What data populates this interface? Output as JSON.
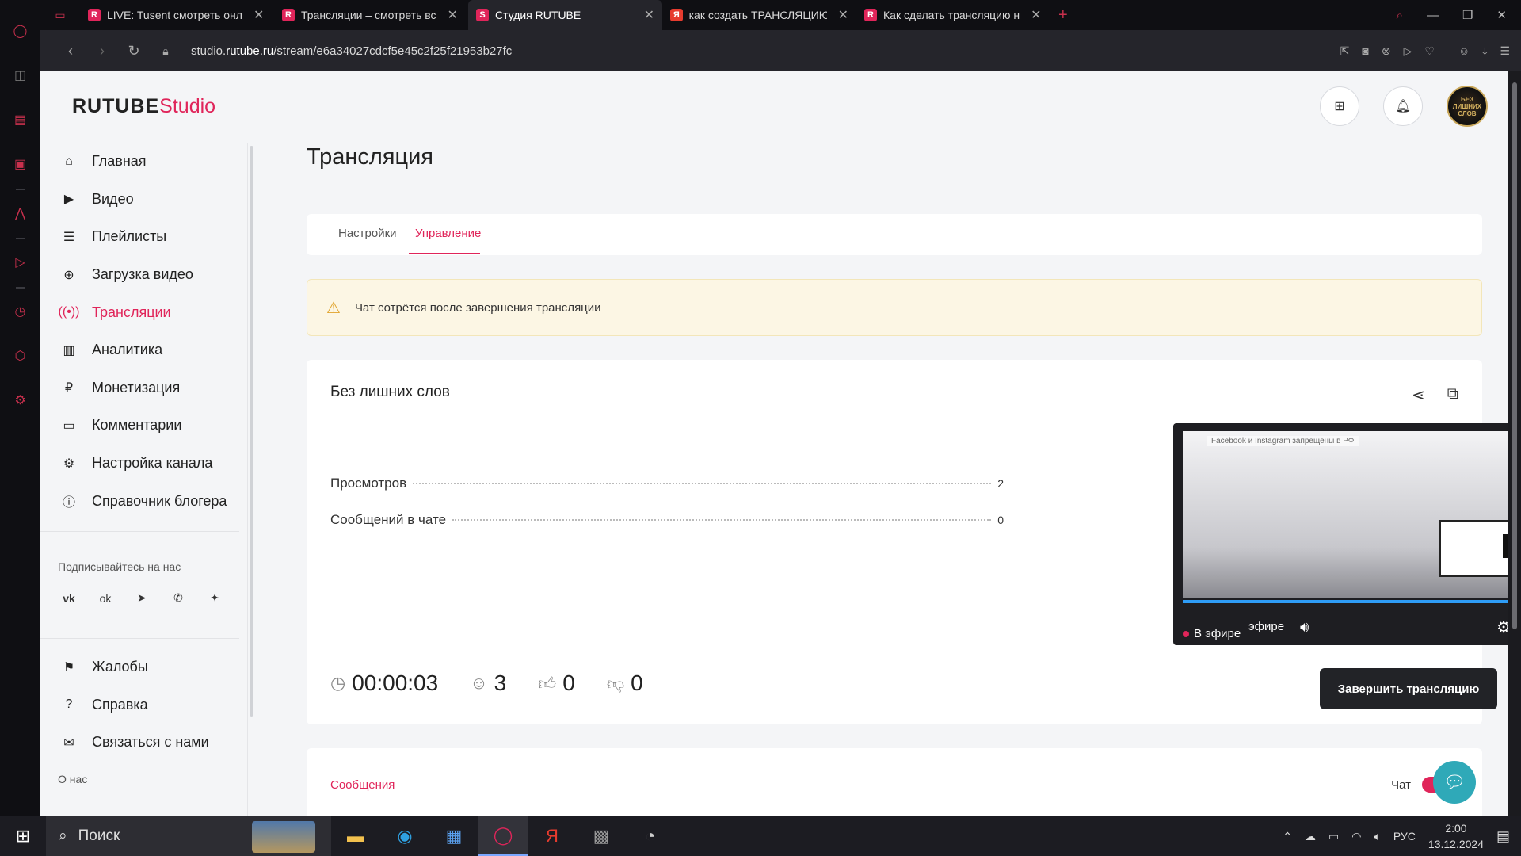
{
  "browser": {
    "tabs": [
      {
        "title": "LIVE: Tusent смотреть онл",
        "favicon": "R",
        "color": "#e0255a"
      },
      {
        "title": "Трансляции – смотреть вс",
        "favicon": "R",
        "color": "#e0255a"
      },
      {
        "title": "Студия RUTUBE",
        "favicon": "S",
        "color": "#e0255a",
        "active": true
      },
      {
        "title": "как создать ТРАНСЛЯЦИЮ",
        "favicon": "Я",
        "color": "#e63b2e"
      },
      {
        "title": "Как сделать трансляцию н",
        "favicon": "R",
        "color": "#e0255a"
      }
    ],
    "url_prefix": "studio.",
    "url_domain": "rutube.ru",
    "url_path": "/stream/e6a34027cdcf5e45c2f25f21953b27fc"
  },
  "studio": {
    "logo_main": "RUTUBE",
    "logo_sub": "Studio",
    "avatar_text": "БЕЗ ЛИШНИХ СЛОВ"
  },
  "sidebar": {
    "items": [
      {
        "label": "Главная",
        "icon": "home-icon"
      },
      {
        "label": "Видео",
        "icon": "video-icon"
      },
      {
        "label": "Плейлисты",
        "icon": "playlist-icon"
      },
      {
        "label": "Загрузка видео",
        "icon": "upload-icon"
      },
      {
        "label": "Трансляции",
        "icon": "broadcast-icon",
        "active": true
      },
      {
        "label": "Аналитика",
        "icon": "analytics-icon"
      },
      {
        "label": "Монетизация",
        "icon": "ruble-icon"
      },
      {
        "label": "Комментарии",
        "icon": "comment-icon"
      },
      {
        "label": "Настройка канала",
        "icon": "gear-icon"
      },
      {
        "label": "Справочник блогера",
        "icon": "info-icon"
      }
    ],
    "follow_label": "Подписывайтесь на нас",
    "socials": [
      "vk-icon",
      "ok-icon",
      "telegram-icon",
      "viber-icon",
      "dzen-icon"
    ],
    "bottom_items": [
      {
        "label": "Жалобы",
        "icon": "flag-icon"
      },
      {
        "label": "Справка",
        "icon": "help-icon"
      },
      {
        "label": "Связаться с нами",
        "icon": "mail-icon"
      }
    ],
    "about_label": "О нас"
  },
  "main": {
    "title": "Трансляция",
    "tabs": [
      "Настройки",
      "Управление"
    ],
    "active_tab": "Управление",
    "alert": "Чат сотрётся после завершения трансляции",
    "stream_title": "Без лишних слов",
    "stats": [
      {
        "label": "Просмотров",
        "value": "2"
      },
      {
        "label": "Сообщений в чате",
        "value": "0"
      }
    ],
    "metrics": {
      "duration": "00:00:03",
      "viewers": "3",
      "likes": "0",
      "dislikes": "0"
    },
    "end_button": "Завершить трансляцию",
    "player": {
      "live_label": "В эфире",
      "live_partial": "эфире",
      "overlay_text": "Facebook и Instagram запрещены в РФ",
      "progress": 1.0
    },
    "messages_tab": "Сообщения",
    "chat_label": "Чат",
    "chat_enabled": true
  },
  "taskbar": {
    "search_label": "Поиск",
    "lang": "РУС",
    "time": "2:00",
    "date": "13.12.2024"
  },
  "colors": {
    "accent": "#e0255a",
    "alert_bg": "#fcf6e4",
    "button_dark": "#222327"
  }
}
